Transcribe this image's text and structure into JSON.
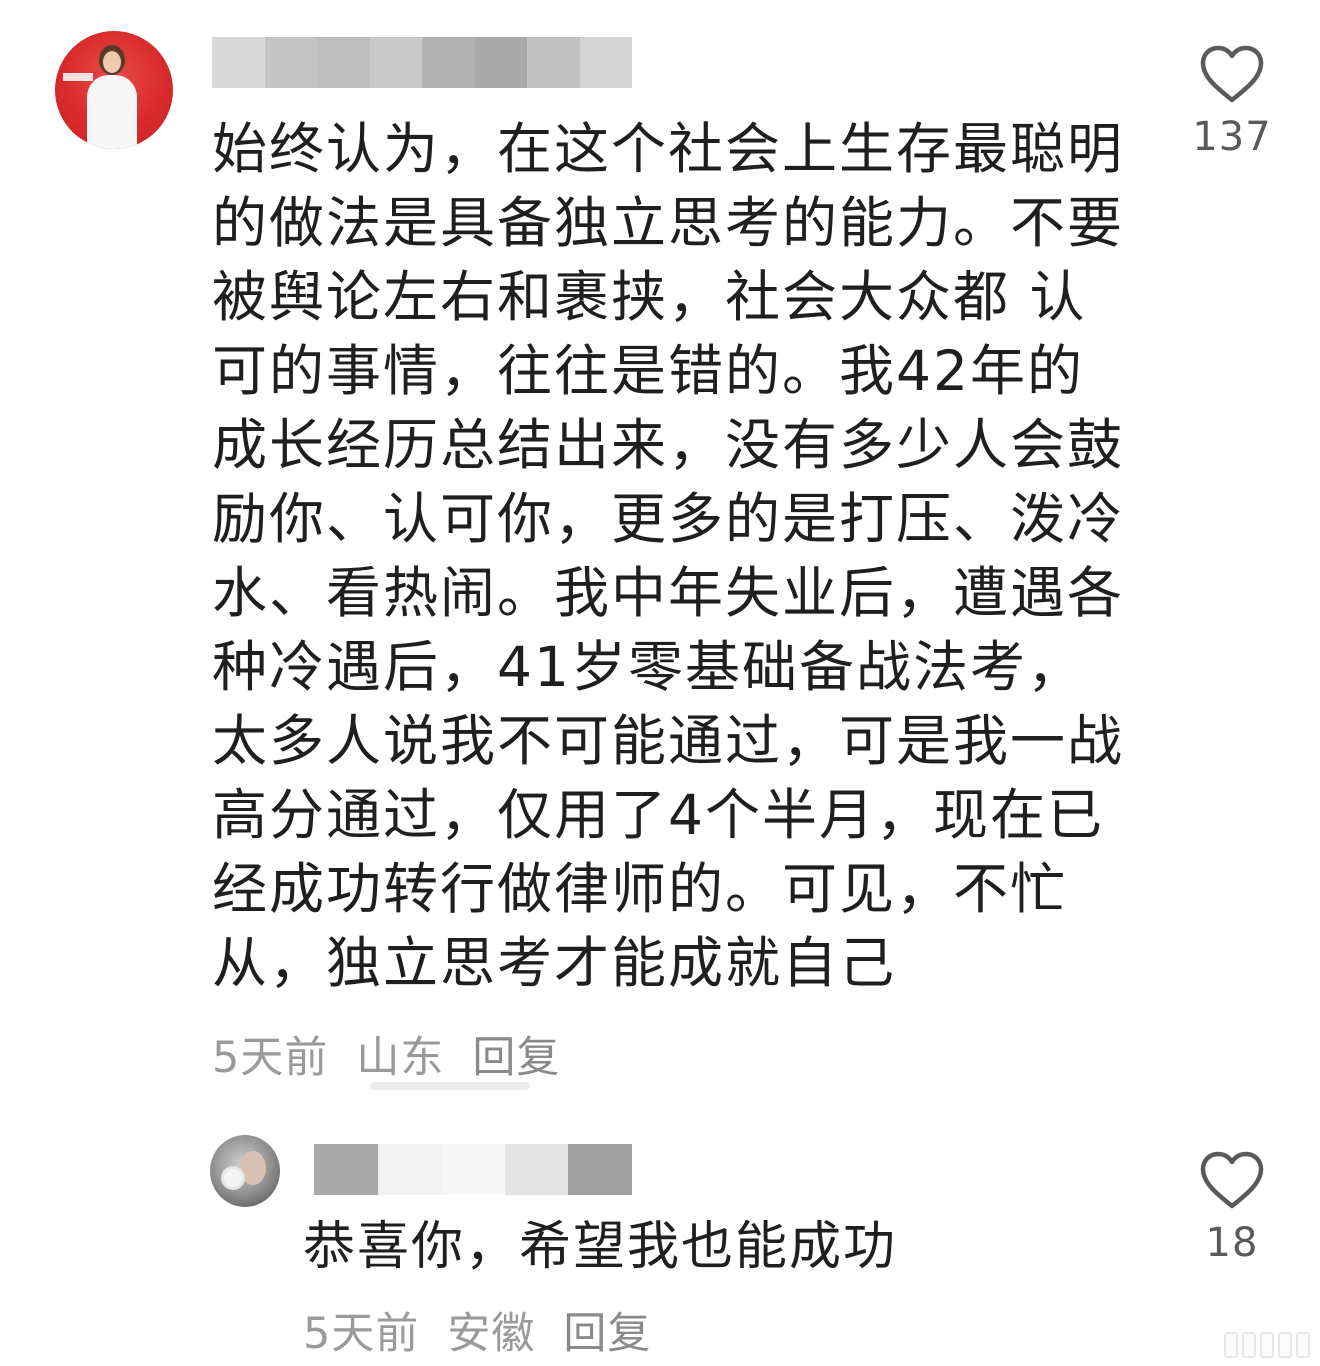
{
  "comments": [
    {
      "avatar_icon": "user-avatar-red-portrait",
      "username_blur_colors": [
        "#d9d9d9",
        "#c4c4c4",
        "#bdbdbd",
        "#c9c9c9",
        "#b2b2b2",
        "#a9a9a9",
        "#c2c2c2",
        "#d4d4d4"
      ],
      "text": "始终认为，在这个社会上生存最聪明的做法是具备独立思考的能力。不要被舆论左右和裹挟，社会大众都 认可的事情，往往是错的。我42年的成长经历总结出来，没有多少人会鼓励你、认可你，更多的是打压、泼冷水、看热闹。我中年失业后，遭遇各种冷遇后，41岁零基础备战法考，太多人说我不可能通过，可是我一战高分通过，仅用了4个半月，现在已经成功转行做律师的。可见，不忙从，独立思考才能成就自己",
      "time": "5天前",
      "location": "山东",
      "reply_label": "回复",
      "like_icon": "heart-outline-icon",
      "like_count": "137"
    },
    {
      "avatar_icon": "user-avatar-gray-portrait",
      "username_blur_colors": [
        "#a9a9a9",
        "#f2f2f2",
        "#f7f7f7",
        "#e4e4e4",
        "#a0a0a0"
      ],
      "text": "恭喜你，希望我也能成功",
      "time": "5天前",
      "location": "安徽",
      "reply_label": "回复",
      "like_icon": "heart-outline-icon",
      "like_count": "18"
    }
  ],
  "colors": {
    "text_primary": "#1f1f1f",
    "text_meta": "#9a9a9a",
    "like_icon": "#5a5a5a",
    "avatar_main_bg": "#d92b2b"
  }
}
